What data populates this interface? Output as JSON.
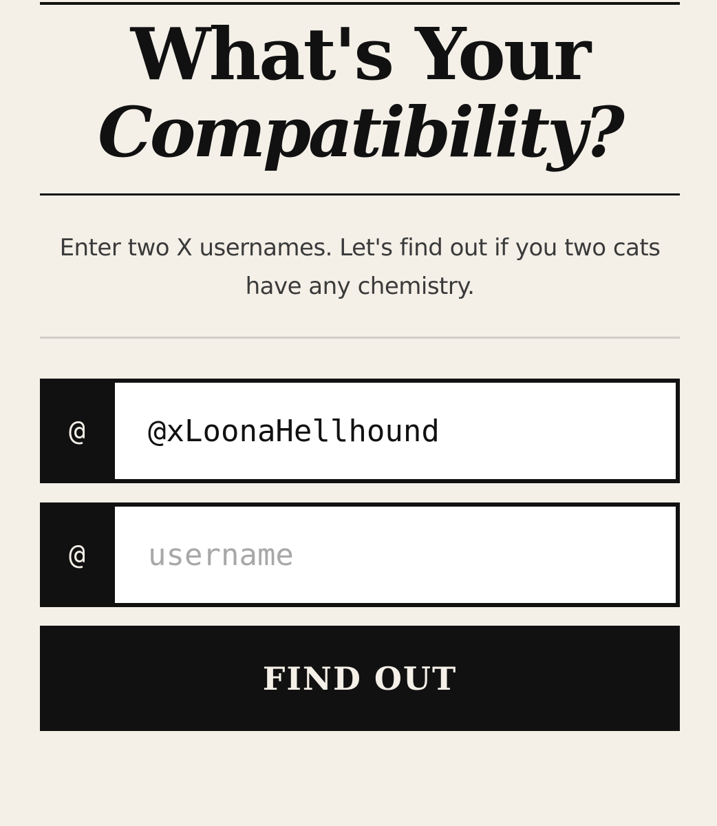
{
  "header": {
    "title_line1": "What's Your",
    "title_line2": "Compatibility?"
  },
  "intro": {
    "text": "Enter two X usernames. Let's find out if you two cats have any chemistry."
  },
  "form": {
    "field1": {
      "prefix": "@",
      "value": "@xLoonaHellhound",
      "placeholder": "username"
    },
    "field2": {
      "prefix": "@",
      "value": "",
      "placeholder": "username"
    },
    "submit_label": "FIND OUT"
  },
  "colors": {
    "background": "#f4f0e8",
    "ink": "#111111",
    "input_bg": "#ffffff",
    "placeholder": "#a8a8a8",
    "divider": "#d0cdc7"
  }
}
